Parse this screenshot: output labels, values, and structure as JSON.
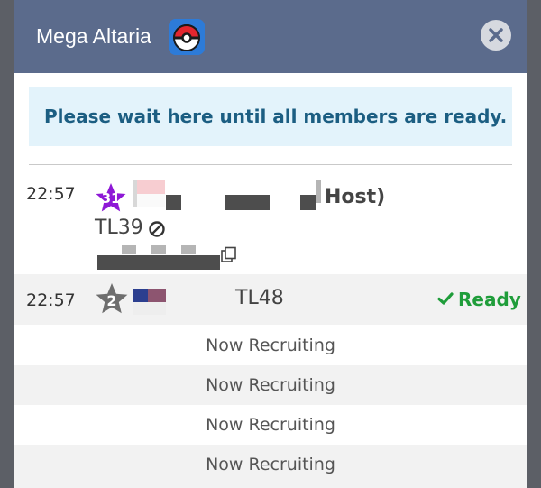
{
  "dialog": {
    "title": "Mega Altaria",
    "notice": "Please wait here until all members are ready."
  },
  "members": [
    {
      "time": "22:57",
      "level": "31",
      "level_color": "#8e18d6",
      "host_label": "Host)",
      "trainer_level": "TL39"
    },
    {
      "time": "22:57",
      "level": "2",
      "level_color": "#6e6e6e",
      "trainer_level": "TL48",
      "status": "Ready"
    }
  ],
  "open_slots": [
    "Now Recruiting",
    "Now Recruiting",
    "Now Recruiting",
    "Now Recruiting"
  ],
  "colors": {
    "header": "#5b6b8c",
    "notice_bg": "#e3f3fb",
    "notice_text": "#1c5e82",
    "ready": "#1f9d3a"
  }
}
